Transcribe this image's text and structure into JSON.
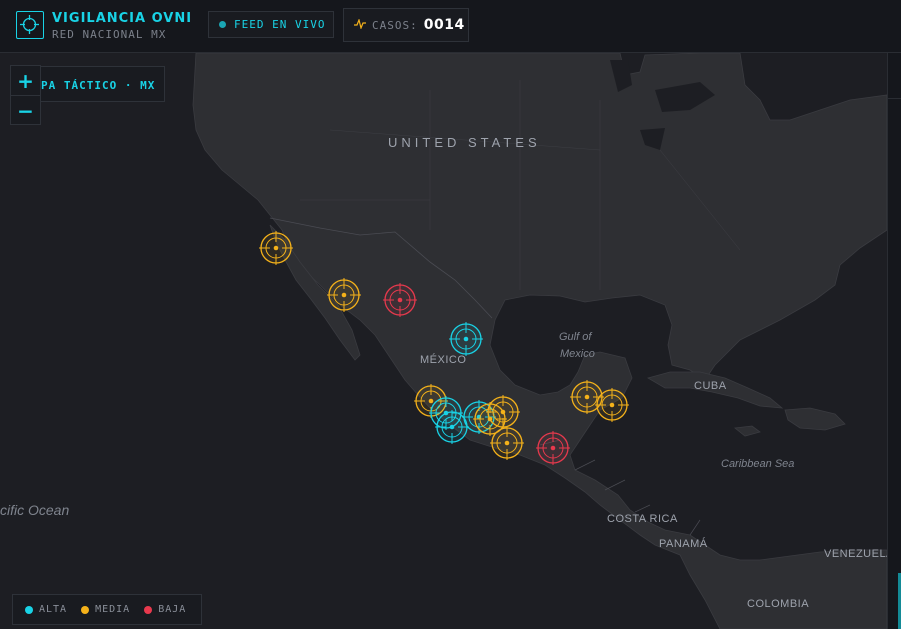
{
  "header": {
    "title": "VIGILANCIA OVNI",
    "subtitle": "RED NACIONAL MX",
    "live_label": "FEED EN VIVO",
    "cases_label": "CASOS:",
    "cases_value": "0014"
  },
  "map": {
    "mode_label": "PA TÁCTICO · MX",
    "zoom_in": "+",
    "zoom_out": "−",
    "labels": {
      "united_states": "UNITED STATES",
      "mexico": "MÉXICO",
      "gulf_line1": "Gulf of",
      "gulf_line2": "Mexico",
      "cuba": "CUBA",
      "caribbean": "Caribbean Sea",
      "pacific": "cific Ocean",
      "costa_rica": "COSTA RICA",
      "panama": "PANAMÁ",
      "venezuela": "VENEZUELA",
      "colombia": "COLOMBIA"
    }
  },
  "legend": {
    "alta": "ALTA",
    "media": "MEDIA",
    "baja": "BAJA"
  },
  "colors": {
    "alta": "#19d3e6",
    "media": "#f5b21a",
    "baja": "#e8394d",
    "accent": "#19d3e6"
  },
  "markers": [
    {
      "level": "media",
      "pos": [
        276,
        195
      ]
    },
    {
      "level": "media",
      "pos": [
        344,
        242
      ]
    },
    {
      "level": "baja",
      "pos": [
        400,
        247
      ]
    },
    {
      "level": "alta",
      "pos": [
        466,
        286
      ]
    },
    {
      "level": "media",
      "pos": [
        431,
        348
      ]
    },
    {
      "level": "alta",
      "pos": [
        446,
        360
      ]
    },
    {
      "level": "alta",
      "pos": [
        452,
        374
      ]
    },
    {
      "level": "alta",
      "pos": [
        479,
        364
      ]
    },
    {
      "level": "media",
      "pos": [
        490,
        366
      ]
    },
    {
      "level": "media",
      "pos": [
        503,
        359
      ]
    },
    {
      "level": "media",
      "pos": [
        507,
        390
      ]
    },
    {
      "level": "baja",
      "pos": [
        553,
        395
      ]
    },
    {
      "level": "media",
      "pos": [
        587,
        344
      ]
    },
    {
      "level": "media",
      "pos": [
        612,
        352
      ]
    }
  ]
}
